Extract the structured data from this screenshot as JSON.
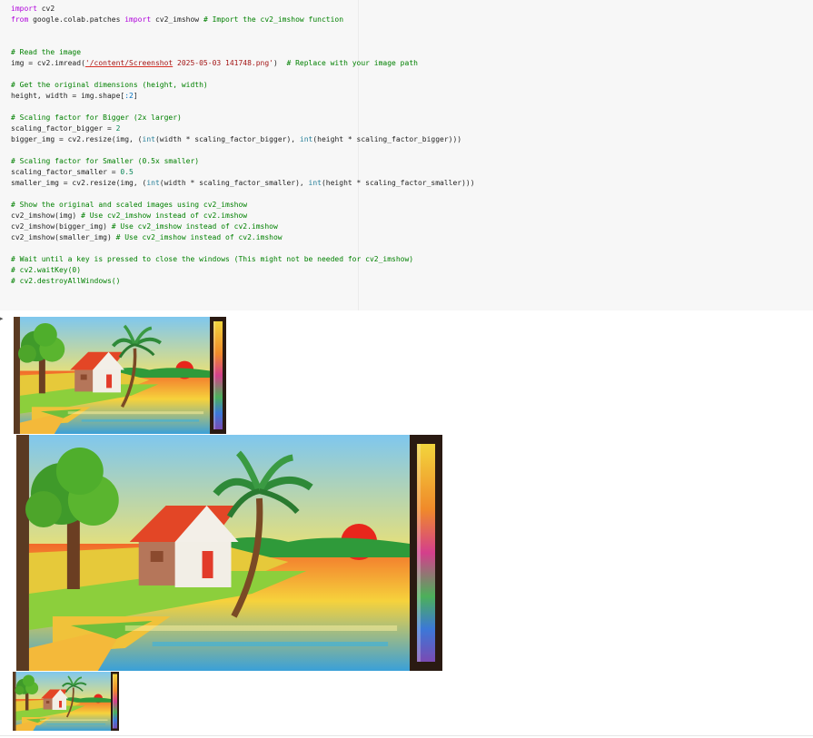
{
  "code_lines": [
    [
      {
        "t": "import",
        "c": "kw"
      },
      {
        "t": " cv2",
        "c": ""
      }
    ],
    [
      {
        "t": "from",
        "c": "kw"
      },
      {
        "t": " google.colab.patches ",
        "c": ""
      },
      {
        "t": "import",
        "c": "kw"
      },
      {
        "t": " cv2_imshow ",
        "c": ""
      },
      {
        "t": "# Import the cv2_imshow function",
        "c": "cm"
      }
    ],
    [],
    [],
    [
      {
        "t": "# Read the image",
        "c": "cm"
      }
    ],
    [
      {
        "t": "img = cv2.imread(",
        "c": ""
      },
      {
        "t": "'/content/Screenshot",
        "c": "st-under"
      },
      {
        "t": " 2025-05-03 141748.png'",
        "c": "st"
      },
      {
        "t": ")  ",
        "c": ""
      },
      {
        "t": "# Replace with your image path",
        "c": "cm"
      }
    ],
    [],
    [
      {
        "t": "# Get the original dimensions (height, width)",
        "c": "cm"
      }
    ],
    [
      {
        "t": "height, width = img.shape[",
        "c": ""
      },
      {
        "t": ":2",
        "c": "nb"
      },
      {
        "t": "]",
        "c": ""
      }
    ],
    [],
    [
      {
        "t": "# Scaling factor for Bigger (2x larger)",
        "c": "cm"
      }
    ],
    [
      {
        "t": "scaling_factor_bigger = ",
        "c": ""
      },
      {
        "t": "2",
        "c": "num"
      }
    ],
    [
      {
        "t": "bigger_img = cv2.resize(img, (",
        "c": ""
      },
      {
        "t": "int",
        "c": "bi"
      },
      {
        "t": "(width * scaling_factor_bigger), ",
        "c": ""
      },
      {
        "t": "int",
        "c": "bi"
      },
      {
        "t": "(height * scaling_factor_bigger)))",
        "c": ""
      }
    ],
    [],
    [
      {
        "t": "# Scaling factor for Smaller (0.5x smaller)",
        "c": "cm"
      }
    ],
    [
      {
        "t": "scaling_factor_smaller = ",
        "c": ""
      },
      {
        "t": "0.5",
        "c": "num"
      }
    ],
    [
      {
        "t": "smaller_img = cv2.resize(img, (",
        "c": ""
      },
      {
        "t": "int",
        "c": "bi"
      },
      {
        "t": "(width * scaling_factor_smaller), ",
        "c": ""
      },
      {
        "t": "int",
        "c": "bi"
      },
      {
        "t": "(height * scaling_factor_smaller)))",
        "c": ""
      }
    ],
    [],
    [
      {
        "t": "# Show the original and scaled images using cv2_imshow",
        "c": "cm"
      }
    ],
    [
      {
        "t": "cv2_imshow(img) ",
        "c": ""
      },
      {
        "t": "# Use cv2_imshow instead of cv2.imshow",
        "c": "cm"
      }
    ],
    [
      {
        "t": "cv2_imshow(bigger_img) ",
        "c": ""
      },
      {
        "t": "# Use cv2_imshow instead of cv2.imshow",
        "c": "cm"
      }
    ],
    [
      {
        "t": "cv2_imshow(smaller_img) ",
        "c": ""
      },
      {
        "t": "# Use cv2_imshow instead of cv2.imshow",
        "c": "cm"
      }
    ],
    [],
    [
      {
        "t": "# Wait until a key is pressed to close the windows (This might not be needed for cv2_imshow)",
        "c": "cm"
      }
    ],
    [
      {
        "t": "# cv2.waitKey(0)",
        "c": "cm"
      }
    ],
    [
      {
        "t": "# cv2.destroyAllWindows()",
        "c": "cm"
      }
    ]
  ],
  "output_images": [
    {
      "name": "original-image-output"
    },
    {
      "name": "bigger-image-output"
    },
    {
      "name": "smaller-image-output"
    }
  ],
  "colors": {
    "cell_bg": "#f7f7f7",
    "keyword": "#af00db",
    "comment": "#008000",
    "string": "#a31515"
  }
}
